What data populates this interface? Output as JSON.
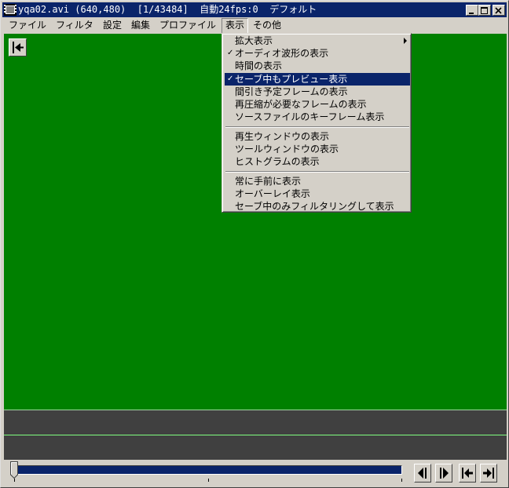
{
  "window": {
    "title": "yqa02.avi (640,480)  [1/43484]  自動24fps:0  デフォルト",
    "controls": [
      "minimize",
      "maximize",
      "close"
    ]
  },
  "menubar": {
    "items": [
      {
        "label": "ファイル"
      },
      {
        "label": "フィルタ"
      },
      {
        "label": "設定"
      },
      {
        "label": "編集"
      },
      {
        "label": "プロファイル"
      },
      {
        "label": "表示",
        "active": true
      },
      {
        "label": "その他"
      }
    ]
  },
  "view_menu": {
    "items": [
      {
        "label": "拡大表示",
        "checked": false,
        "submenu": true
      },
      {
        "label": "オーディオ波形の表示",
        "checked": true
      },
      {
        "label": "時間の表示",
        "checked": false
      },
      {
        "label": "セーブ中もプレビュー表示",
        "checked": true,
        "highlighted": true
      },
      {
        "label": "間引き予定フレームの表示",
        "checked": false
      },
      {
        "label": "再圧縮が必要なフレームの表示",
        "checked": false
      },
      {
        "label": "ソースファイルのキーフレーム表示",
        "checked": false
      },
      {
        "label": "再生ウィンドウの表示",
        "checked": false
      },
      {
        "label": "ツールウィンドウの表示",
        "checked": false
      },
      {
        "label": "ヒストグラムの表示",
        "checked": false
      },
      {
        "label": "常に手前に表示",
        "checked": false
      },
      {
        "label": "オーバーレイ表示",
        "checked": false
      },
      {
        "label": "セーブ中のみフィルタリングして表示",
        "checked": false
      }
    ],
    "check_mark": "✓"
  },
  "preview": {
    "background_color": "#008000"
  },
  "timeline": {
    "position_fraction": 0.0
  },
  "colors": {
    "titlebar": "#0a246a",
    "menu_highlight": "#0a246a",
    "face": "#d4d0c8"
  }
}
